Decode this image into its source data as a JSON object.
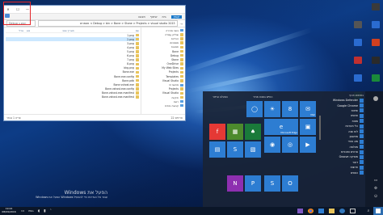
{
  "explorer": {
    "title": "",
    "window_controls": [
      "✕",
      "☐",
      "—"
    ],
    "ribbon_tabs": [
      "קובץ",
      "בית",
      "שיתוף",
      "תצוגה"
    ],
    "address_path": "Debug > bin > Bone > Stone > Projects > visual studio 2015 > מסמכים",
    "search_placeholder": "Debug חפש ב",
    "columns": {
      "name": "שם",
      "date": "תאריך שינוי",
      "type": "סוג",
      "size": "גודל"
    },
    "files": [
      {
        "name": "1.png",
        "date": "",
        "type": "",
        "size": ""
      },
      {
        "name": "2.png",
        "date": "",
        "type": "",
        "size": ""
      },
      {
        "name": "3.png",
        "date": "",
        "type": "",
        "size": ""
      },
      {
        "name": "4.png",
        "date": "",
        "type": "",
        "size": ""
      },
      {
        "name": "5.png",
        "date": "",
        "type": "",
        "size": ""
      },
      {
        "name": "6.png",
        "date": "",
        "type": "",
        "size": ""
      },
      {
        "name": "7.png",
        "date": "",
        "type": "",
        "size": ""
      },
      {
        "name": "8.png",
        "date": "",
        "type": "",
        "size": ""
      },
      {
        "name": "bkg.png",
        "date": "",
        "type": "",
        "size": ""
      },
      {
        "name": "Bone.exe",
        "date": "",
        "type": "",
        "size": ""
      },
      {
        "name": "Bone.exe.config",
        "date": "",
        "type": "",
        "size": ""
      },
      {
        "name": "Bone.pdb",
        "date": "",
        "type": "",
        "size": ""
      },
      {
        "name": "Bone.vshost.exe",
        "date": "",
        "type": "",
        "size": ""
      },
      {
        "name": "Bone.vshost.exe.config",
        "date": "",
        "type": "",
        "size": ""
      },
      {
        "name": "Bone.vshost.exe.manifest",
        "date": "",
        "type": "",
        "size": ""
      },
      {
        "name": "Bone.vshost.exe.manifest",
        "date": "",
        "type": "",
        "size": ""
      }
    ],
    "nav": [
      {
        "label": "גישה מהירה",
        "kind": "pc"
      },
      {
        "label": "שולחן עבודה",
        "kind": "folder"
      },
      {
        "label": "הורדות",
        "kind": "folder"
      },
      {
        "label": "מסמכים",
        "kind": "folder"
      },
      {
        "label": "תמונות",
        "kind": "folder"
      },
      {
        "label": "Bone",
        "kind": "folder"
      },
      {
        "label": "Debug",
        "kind": "folder"
      },
      {
        "label": "Stone",
        "kind": "folder"
      },
      {
        "label": "OneDrive",
        "kind": "folder"
      },
      {
        "label": "My Web Sites",
        "kind": "folder"
      },
      {
        "label": "Projects",
        "kind": "folder"
      },
      {
        "label": "Templates",
        "kind": "folder"
      },
      {
        "label": "Visual Studio",
        "kind": "folder"
      },
      {
        "label": "מחשב זה",
        "kind": "pc"
      },
      {
        "label": "Projects",
        "kind": "folder"
      },
      {
        "label": "Visual Studio",
        "kind": "folder"
      },
      {
        "label": "תיקיות",
        "kind": "folder"
      },
      {
        "label": "רשת",
        "kind": "pc"
      },
      {
        "label": "קבוצה ביתית",
        "kind": "pc"
      }
    ],
    "status_left": "פריט 1 נבחר",
    "status_right": "פריטים 22"
  },
  "start_menu": {
    "apps": [
      "Windows Defender",
      "Google Chrome",
      "שיחות",
      "אנשים",
      "מפות",
      "כלי מערכת",
      "לוח שנה",
      "מחשבון",
      "מזג אוויר",
      "מצלמה",
      "סרטים ותוכניות",
      "Groove מוסיקה",
      "דואר",
      "חדשות",
      "כספים"
    ],
    "apps_group_label": "בשימוש תכוף",
    "rail_icons": [
      "avatar-icon",
      "documents-icon",
      "settings-icon",
      "power-icon"
    ],
    "tile_groups": [
      "החיים במבט מהיר",
      "הפעלה ובידור"
    ],
    "tiles": [
      {
        "label": "",
        "color": "#2d7dd2",
        "kind": "calendar",
        "text": "8"
      },
      {
        "label": "Mail",
        "color": "#2d7dd2",
        "kind": "mail"
      },
      {
        "label": "Microsoft Edge",
        "color": "#2d7dd2",
        "kind": "edge"
      },
      {
        "label": "",
        "color": "#2d7dd2",
        "kind": "photos"
      },
      {
        "label": "",
        "color": "#2d7dd2",
        "kind": "cortana"
      },
      {
        "label": "",
        "color": "#2d7dd2",
        "kind": "weather"
      },
      {
        "label": "",
        "color": "#e53935",
        "kind": "flipboard"
      },
      {
        "label": "",
        "color": "#4c8a2d",
        "kind": "minecraft"
      },
      {
        "label": "",
        "color": "#1a7a3a",
        "kind": "solitaire"
      },
      {
        "label": "",
        "color": "#2d7dd2",
        "kind": "xbox"
      },
      {
        "label": "",
        "color": "#2d7dd2",
        "kind": "groove"
      },
      {
        "label": "",
        "color": "#2d7dd2",
        "kind": "movies"
      },
      {
        "label": "",
        "color": "#2d7dd2",
        "kind": "store"
      },
      {
        "label": "",
        "color": "#2d7dd2",
        "kind": "skype"
      },
      {
        "label": "",
        "color": "#2d7dd2",
        "kind": "news"
      },
      {
        "label": "",
        "color": "#8e2fb0",
        "kind": "onenote"
      },
      {
        "label": "",
        "color": "#2d7dd2",
        "kind": "picsart"
      },
      {
        "label": "",
        "color": "#2d7dd2",
        "kind": "sway"
      },
      {
        "label": "",
        "color": "#2d7dd2",
        "kind": "getoffice"
      }
    ]
  },
  "desktop_icons_right": [
    {
      "label": "",
      "color": "#3a3a3a"
    },
    {
      "label": "",
      "color": "#2a6bd0"
    },
    {
      "label": "",
      "color": "#d04020"
    },
    {
      "label": "",
      "color": "#2a2a2a"
    },
    {
      "label": "",
      "color": "#1a8a3a"
    }
  ],
  "desktop_icons_right2": [
    {
      "label": "",
      "color": "#555"
    },
    {
      "label": "",
      "color": "#2a6bd0"
    },
    {
      "label": "",
      "color": "#c03030"
    },
    {
      "label": "",
      "color": "#2a6bd0"
    },
    {
      "label": "",
      "color": "#1a8a3a"
    }
  ],
  "watermark": {
    "title": "Windows הפעל את",
    "subtitle": "Windows הפעל את Windows עבור אל הגדרות כדי להפעיל"
  },
  "taskbar": {
    "time": "19:24",
    "date": "08/09/2016",
    "tray_icons": [
      "notifications-icon",
      "language-indicator",
      "volume-icon",
      "network-icon",
      "chevron-up-icon"
    ],
    "language": "ENG"
  }
}
